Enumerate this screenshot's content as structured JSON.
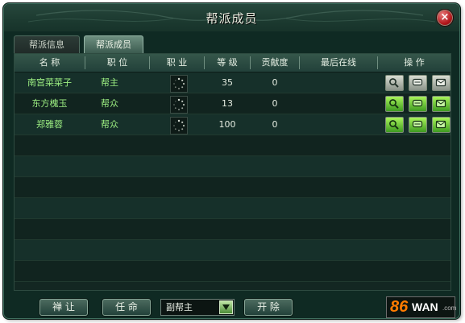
{
  "window": {
    "title": "帮派成员",
    "close_symbol": "×"
  },
  "tabs": [
    {
      "label": "帮派信息",
      "active": false
    },
    {
      "label": "帮派成员",
      "active": true
    }
  ],
  "table": {
    "columns": [
      "名 称",
      "职 位",
      "职 业",
      "等 级",
      "贡献度",
      "最后在线",
      "操 作"
    ],
    "rows": [
      {
        "name": "南宫菜菜子",
        "position": "帮主",
        "level": "35",
        "contribution": "0",
        "last_online": ""
      },
      {
        "name": "东方槐玉",
        "position": "帮众",
        "level": "13",
        "contribution": "0",
        "last_online": ""
      },
      {
        "name": "郑雅蓉",
        "position": "帮众",
        "level": "100",
        "contribution": "0",
        "last_online": ""
      }
    ],
    "empty_rows": 8
  },
  "footer": {
    "transfer_label": "禅 让",
    "appoint_label": "任 命",
    "rank_select_value": "副帮主",
    "expel_label": "开 除"
  },
  "logo": {
    "number": "86",
    "brand": "WAN",
    "suffix": ".com"
  },
  "icons": {
    "close": "close-icon",
    "class_loading": "loading-spinner-icon",
    "inspect": "magnifier-icon",
    "chat": "chat-icon",
    "mail": "mail-icon",
    "dropdown": "chevron-down-icon"
  },
  "colors": {
    "member_name": "#9ef083",
    "op_active": "#6fd13a",
    "op_inactive": "#bfc5bb",
    "panel_bg": "#132722",
    "logo_orange": "#ff7b00"
  }
}
